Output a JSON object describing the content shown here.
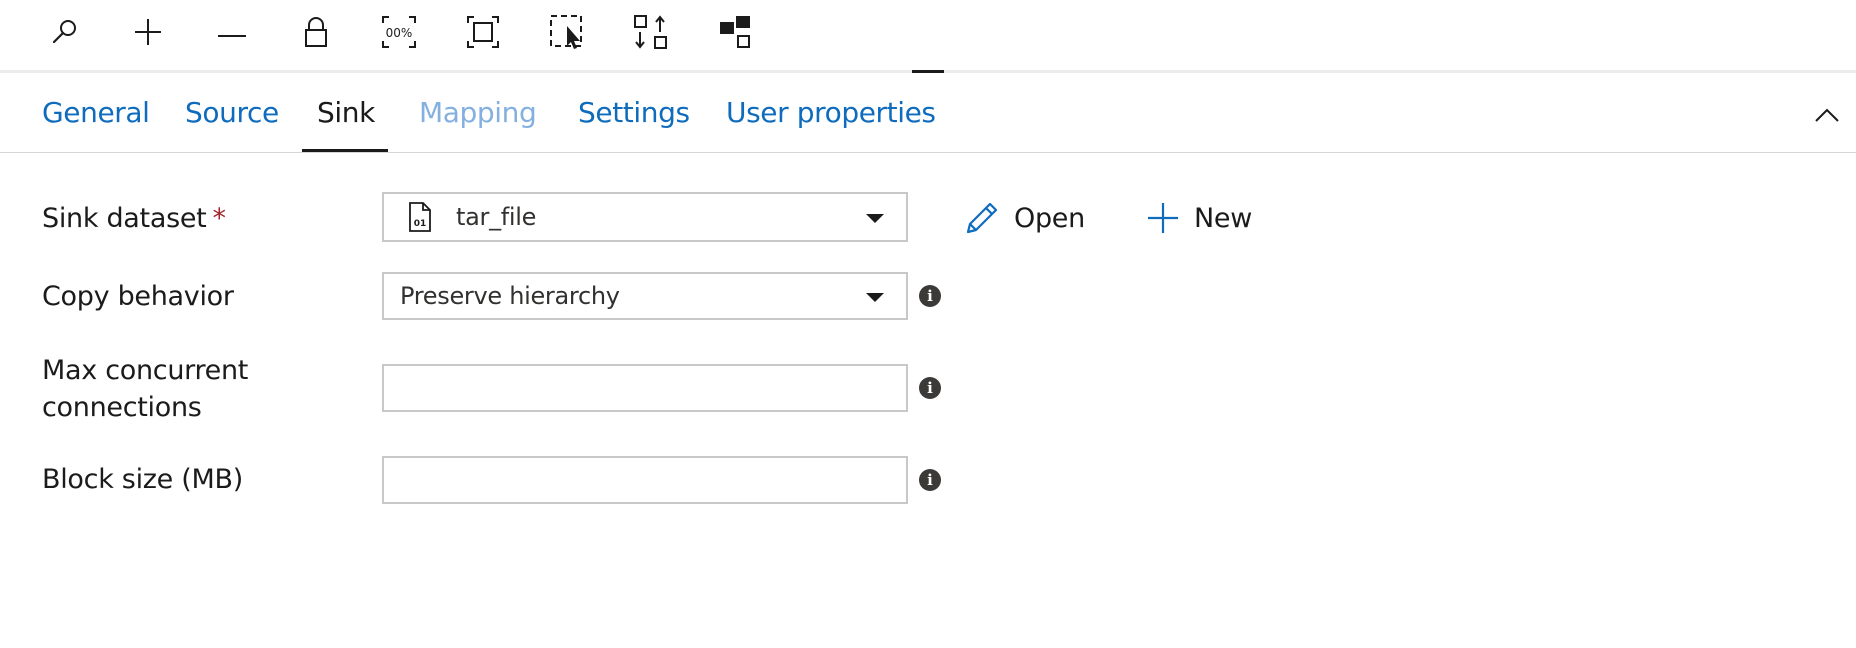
{
  "toolbar": {
    "buttons": [
      {
        "name": "search",
        "icon": "search-icon"
      },
      {
        "name": "zoom-in",
        "icon": "plus-icon"
      },
      {
        "name": "zoom-out",
        "icon": "minus-icon"
      },
      {
        "name": "lock",
        "icon": "lock-icon"
      },
      {
        "name": "zoom-100",
        "icon": "zoom-100-icon",
        "text": "00%"
      },
      {
        "name": "fit-to-screen",
        "icon": "fit-screen-icon"
      },
      {
        "name": "select",
        "icon": "select-cursor-icon"
      },
      {
        "name": "auto-align",
        "icon": "auto-align-icon"
      },
      {
        "name": "layout",
        "icon": "layout-icon"
      }
    ]
  },
  "tabs": [
    {
      "label": "General",
      "state": "normal"
    },
    {
      "label": "Source",
      "state": "normal"
    },
    {
      "label": "Sink",
      "state": "active"
    },
    {
      "label": "Mapping",
      "state": "disabled"
    },
    {
      "label": "Settings",
      "state": "normal"
    },
    {
      "label": "User properties",
      "state": "normal"
    }
  ],
  "form": {
    "sink_dataset": {
      "label": "Sink dataset",
      "required_marker": "*",
      "value": "tar_file",
      "icon": "binary-file-icon",
      "icon_text": "01",
      "open_label": "Open",
      "new_label": "New"
    },
    "copy_behavior": {
      "label": "Copy behavior",
      "value": "Preserve hierarchy"
    },
    "max_concurrent": {
      "label_line1": "Max concurrent",
      "label_line2": "connections",
      "value": ""
    },
    "block_size": {
      "label": "Block size (MB)",
      "value": ""
    },
    "info_glyph": "i"
  },
  "colors": {
    "link": "#0f6cbd",
    "link_disabled": "#84b0e0",
    "required": "#a4262c",
    "border": "#c8c8c8",
    "text": "#1b1b1b"
  }
}
